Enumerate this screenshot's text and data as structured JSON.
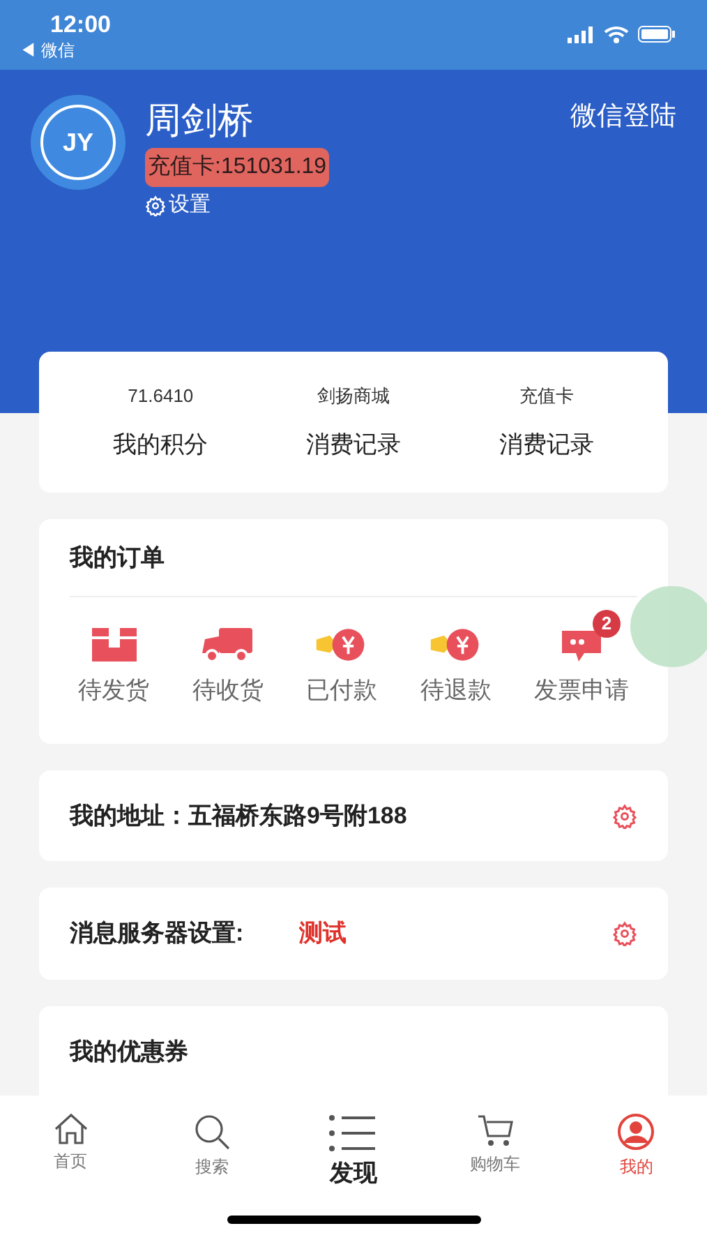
{
  "status_bar": {
    "time": "12:00",
    "back_label": "◀ 微信"
  },
  "profile": {
    "name": "周剑桥",
    "logo_text": "JY",
    "balance": "充值卡:151031.19",
    "settings": "设置",
    "login": "微信登陆"
  },
  "stats": [
    {
      "value": "71.6410",
      "label": "我的积分"
    },
    {
      "value": "剑扬商城",
      "label": "消费记录"
    },
    {
      "value": "充值卡",
      "label": "消费记录"
    }
  ],
  "orders": {
    "title": "我的订单",
    "items": [
      {
        "kind": "box",
        "label": "待发货"
      },
      {
        "kind": "truck",
        "label": "待收货"
      },
      {
        "kind": "wallet",
        "label": "已付款"
      },
      {
        "kind": "wallet",
        "label": "待退款"
      },
      {
        "kind": "chat",
        "label": "发票申请",
        "badge": "2"
      }
    ]
  },
  "address": {
    "label": "我的地址：",
    "value": "五福桥东路9号附188"
  },
  "server": {
    "label": "消息服务器设置:",
    "value": "测试"
  },
  "coupons": {
    "title": "我的优惠券"
  },
  "tabs": [
    {
      "kind": "home",
      "label": "首页",
      "selected": false
    },
    {
      "kind": "search",
      "label": "搜索",
      "selected": false
    },
    {
      "kind": "list",
      "label": "发现",
      "selected": false
    },
    {
      "kind": "cart",
      "label": "购物车",
      "selected": false
    },
    {
      "kind": "user",
      "label": "我的",
      "selected": true
    }
  ]
}
